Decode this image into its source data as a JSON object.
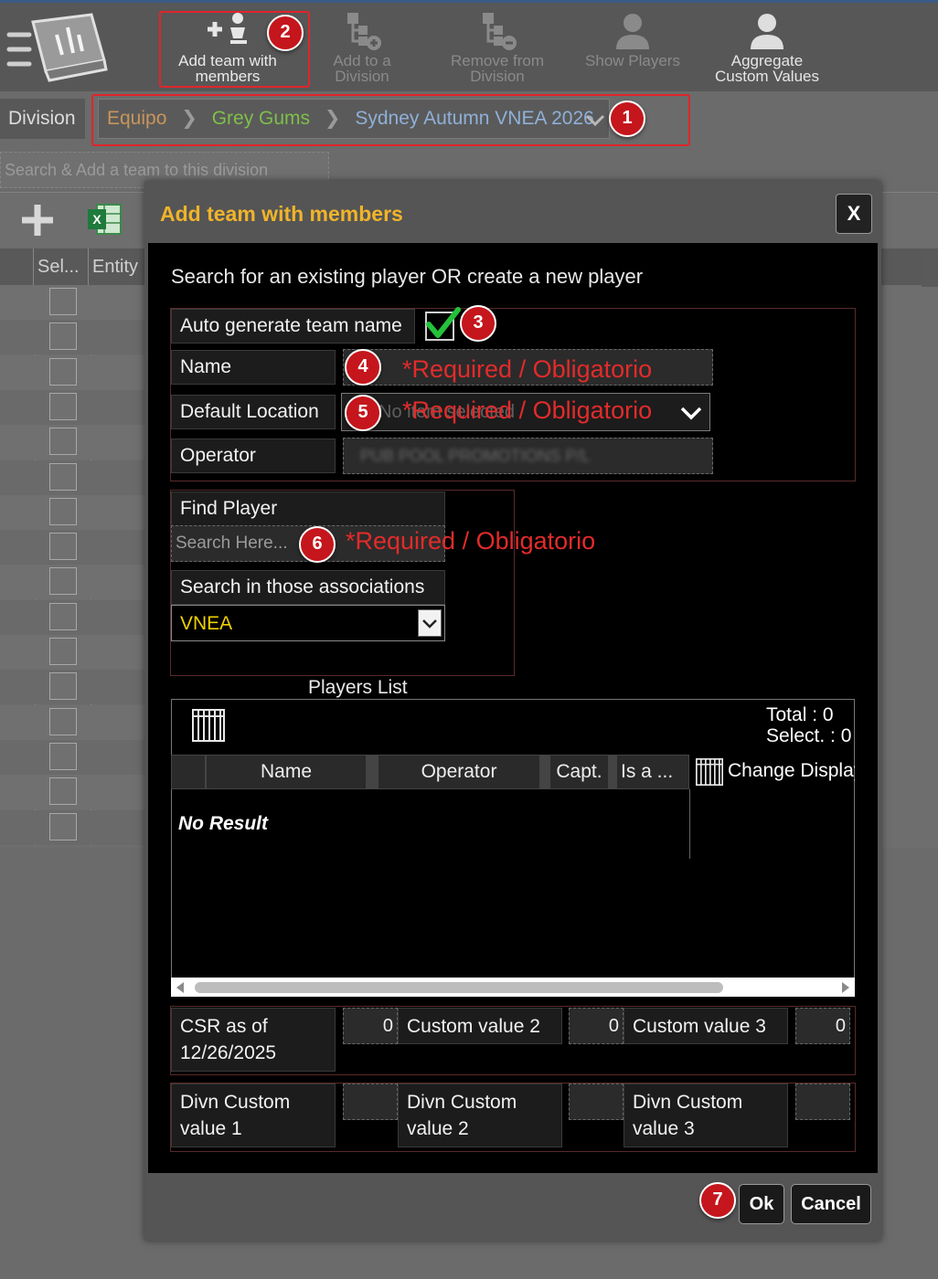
{
  "toolbar": {
    "add_team": "Add team with members",
    "add_division": "Add to a Division",
    "remove_division": "Remove from Division",
    "show_players": "Show Players",
    "aggregate": "Aggregate Custom Values"
  },
  "division": {
    "label": "Division",
    "crumb1": "Equipo",
    "crumb2": "Grey Gums",
    "crumb3": "Sydney Autumn VNEA 2026"
  },
  "search_placeholder": "Search & Add a team to this division",
  "background_grid": {
    "col_select": "Sel...",
    "col_entity": "Entity",
    "row_count": 16
  },
  "modal": {
    "title": "Add team with members",
    "close": "X",
    "intro": "Search for an existing player OR create a new player",
    "auto_label": "Auto generate team name",
    "auto_checked": true,
    "name_label": "Name",
    "location_label": "Default Location",
    "location_placeholder": "No item selected",
    "operator_label": "Operator",
    "operator_value": "PUB POOL PROMOTIONS P/L",
    "required_text": "*Required / Obligatorio",
    "find_label": "Find Player",
    "find_placeholder": "Search Here...",
    "assoc_label": "Search in those associations",
    "assoc_value": "VNEA",
    "players_list_title": "Players List",
    "total": "Total : 0",
    "select": "Select. : 0",
    "columns": [
      "Name",
      "Operator",
      "Capt.",
      "Is a ..."
    ],
    "change_display": "Change Display",
    "no_result": "No Result",
    "custom": [
      {
        "label": "CSR as of 12/26/2025",
        "value": "0"
      },
      {
        "label": "Custom value 2",
        "value": "0"
      },
      {
        "label": "Custom value 3",
        "value": "0"
      }
    ],
    "divn": [
      {
        "label": "Divn Custom value 1",
        "value": ""
      },
      {
        "label": "Divn Custom value 2",
        "value": ""
      },
      {
        "label": "Divn Custom value 3",
        "value": ""
      }
    ],
    "ok": "Ok",
    "cancel": "Cancel"
  },
  "badges": [
    "1",
    "2",
    "3",
    "4",
    "5",
    "6",
    "7"
  ],
  "colors": {
    "accent_title": "#f0b42a",
    "annotation_red": "#e0252b",
    "crumb1": "#c8955a",
    "crumb2": "#7fbf4a",
    "crumb3": "#8fb0d8",
    "assoc": "#f0d000"
  }
}
